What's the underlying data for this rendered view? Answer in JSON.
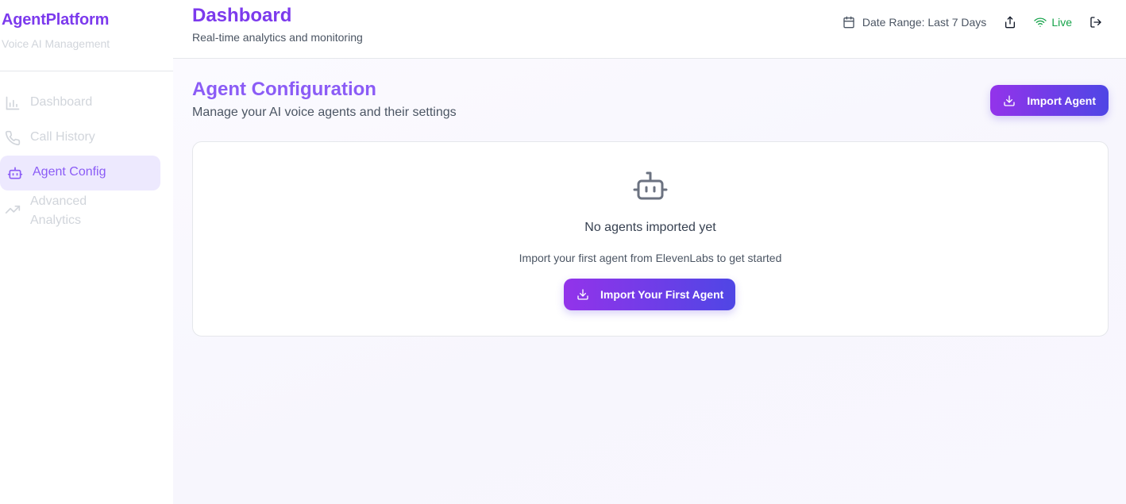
{
  "sidebar": {
    "brand_title": "AgentPlatform",
    "brand_subtitle": "Voice AI Management",
    "items": [
      {
        "label": "Dashboard",
        "icon": "bar-chart-icon",
        "active": false
      },
      {
        "label": "Call History",
        "icon": "phone-icon",
        "active": false
      },
      {
        "label": "Agent Config",
        "icon": "bot-icon",
        "active": true
      },
      {
        "label": "Advanced Analytics",
        "icon": "trending-up-icon",
        "active": false
      }
    ]
  },
  "header": {
    "title": "Dashboard",
    "subtitle": "Real-time analytics and monitoring",
    "date_range": "Date Range: Last 7 Days",
    "live_label": "Live"
  },
  "main": {
    "title": "Agent Configuration",
    "subtitle": "Manage your AI voice agents and their settings",
    "import_button": "Import Agent",
    "empty_state": {
      "title": "No agents imported yet",
      "description": "Import your first agent from ElevenLabs to get started",
      "button": "Import Your First Agent",
      "icon": "bot-icon"
    }
  },
  "colors": {
    "brand": "#7c3aed",
    "active_bg": "#ede9fe",
    "live": "#16a34a",
    "gradient_start": "#9333ea",
    "gradient_end": "#4f46e5"
  }
}
